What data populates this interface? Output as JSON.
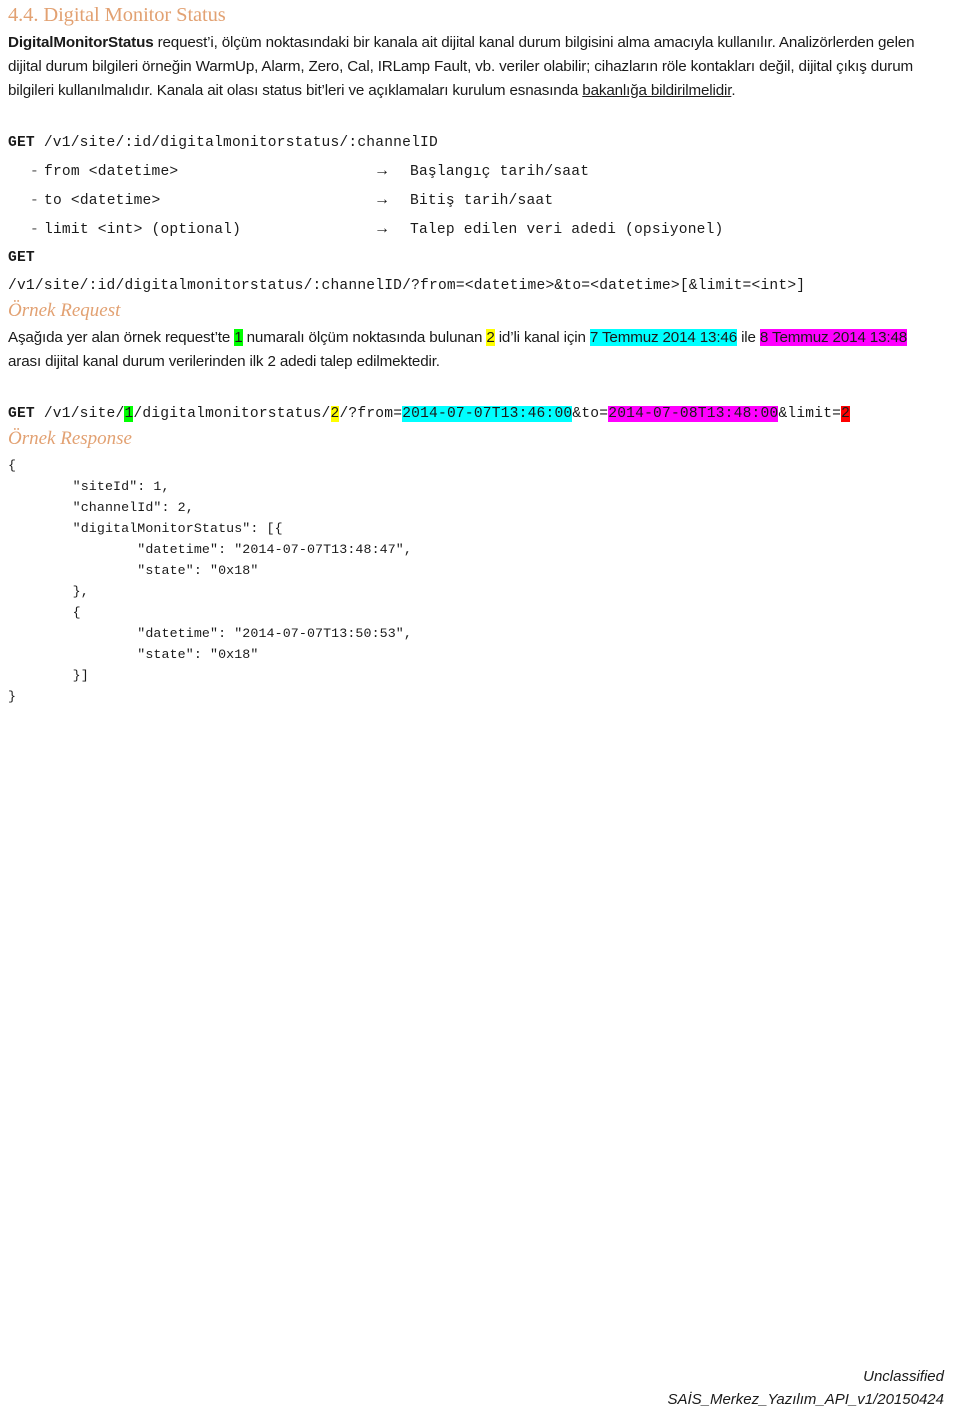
{
  "document": {
    "section_number": "4.4.",
    "section_title": "Digital Monitor Status",
    "heading_full": "4.4. Digital Monitor Status",
    "accent_color": "#E2A172"
  },
  "intro": {
    "bold_term": "DigitalMonitorStatus",
    "text_part1": " request’i, ölçüm noktasındaki bir kanala ait dijital kanal durum bilgisini alma amacıyla kullanılır. Analizörlerden gelen dijital durum bilgileri örneğin WarmUp, Alarm, Zero, Cal, IRLamp Fault, vb. veriler olabilir; cihazların röle kontakları değil, dijital çıkış durum bilgileri kullanılmalıdır. Kanala ait olası status bit’leri ve açıklamaları kurulum esnasında ",
    "underlined_text": "bakanlığa bildirilmelidir",
    "text_part2": "."
  },
  "endpoint": {
    "verb": "GET",
    "path": " /v1/site/:id/digitalmonitorstatus/:channelID",
    "params": [
      {
        "dash": "-",
        "name": "from <datetime>",
        "arrow": "→",
        "desc": "Başlangıç tarih/saat"
      },
      {
        "dash": "-",
        "name": "to <datetime>",
        "arrow": "→",
        "desc": "Bitiş tarih/saat"
      },
      {
        "dash": "-",
        "name": "limit <int> (optional)",
        "arrow": "→",
        "desc": "Talep edilen veri adedi (opsiyonel)"
      }
    ],
    "verb2": "GET",
    "full_url": "/v1/site/:id/digitalmonitorstatus/:channelID/?from=<datetime>&to=<datetime>[&limit=<int>]"
  },
  "example_request": {
    "heading": "Örnek Request",
    "par": {
      "t1": "Aşağıda yer alan örnek request’te ",
      "site_id": "1",
      "t2": " numaralı ölçüm noktasında bulunan ",
      "channel_id": "2",
      "t3": " id’li kanal için ",
      "from_human": "7 Temmuz 2014 13:46",
      "t4": " ile ",
      "to_human": "8 Temmuz 2014 13:48",
      "t5": " arası dijital kanal durum verilerinden ilk 2 adedi talep edilmektedir."
    },
    "url": {
      "verb": "GET",
      "p1": " /v1/site/",
      "site_id": "1",
      "p2": "/digitalmonitorstatus/",
      "channel_id": "2",
      "p3": "/?from=",
      "from_iso": "2014-07-07T13:46:00",
      "p4": "&to=",
      "to_iso": "2014-07-08T13:48:00",
      "p5": "&limit=",
      "limit": "2"
    }
  },
  "example_response": {
    "heading": "Örnek Response",
    "json_text": "{\n        \"siteId\": 1,\n        \"channelId\": 2,\n        \"digitalMonitorStatus\": [{\n                \"datetime\": \"2014-07-07T13:48:47\",\n                \"state\": \"0x18\"\n        },\n        {\n                \"datetime\": \"2014-07-07T13:50:53\",\n                \"state\": \"0x18\"\n        }]\n}",
    "fields": {
      "siteId": 1,
      "channelId": 2,
      "digitalMonitorStatus": [
        {
          "datetime": "2014-07-07T13:48:47",
          "state": "0x18"
        },
        {
          "datetime": "2014-07-07T13:50:53",
          "state": "0x18"
        }
      ]
    }
  },
  "footer": {
    "classification": "Unclassified",
    "doc_id": "SAİS_Merkez_Yazılım_API_v1/20150424"
  }
}
